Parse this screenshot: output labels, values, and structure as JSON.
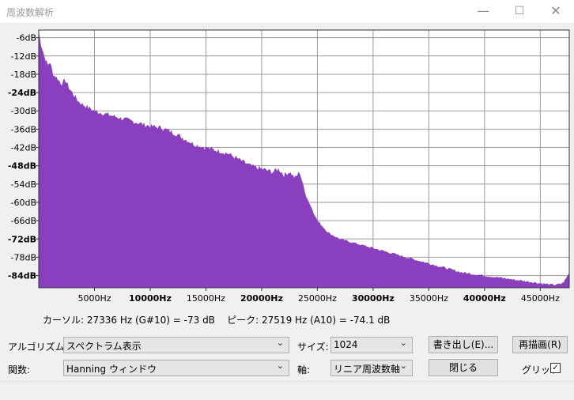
{
  "window": {
    "title": "周波数解析",
    "minimize_glyph": "—",
    "maximize_glyph": "☐",
    "close_glyph": "✕"
  },
  "chart_data": {
    "type": "area",
    "title": "",
    "xlabel": "",
    "ylabel": "",
    "fill_color": "#8a3fbf",
    "grid": true,
    "xlim": [
      0,
      47600
    ],
    "ylim": [
      -88,
      -3.5
    ],
    "x_ticks": [
      {
        "value": 5000,
        "label": "5000Hz",
        "bold": false
      },
      {
        "value": 10000,
        "label": "10000Hz",
        "bold": true
      },
      {
        "value": 15000,
        "label": "15000Hz",
        "bold": false
      },
      {
        "value": 20000,
        "label": "20000Hz",
        "bold": true
      },
      {
        "value": 25000,
        "label": "25000Hz",
        "bold": false
      },
      {
        "value": 30000,
        "label": "30000Hz",
        "bold": true
      },
      {
        "value": 35000,
        "label": "35000Hz",
        "bold": false
      },
      {
        "value": 40000,
        "label": "40000Hz",
        "bold": true
      },
      {
        "value": 45000,
        "label": "45000Hz",
        "bold": false
      }
    ],
    "y_ticks": [
      {
        "value": -6,
        "label": "-6dB",
        "bold": false
      },
      {
        "value": -12,
        "label": "-12dB",
        "bold": false
      },
      {
        "value": -18,
        "label": "-18dB",
        "bold": false
      },
      {
        "value": -24,
        "label": "-24dB",
        "bold": true
      },
      {
        "value": -30,
        "label": "-30dB",
        "bold": false
      },
      {
        "value": -36,
        "label": "-36dB",
        "bold": false
      },
      {
        "value": -42,
        "label": "-42dB",
        "bold": false
      },
      {
        "value": -48,
        "label": "-48dB",
        "bold": true
      },
      {
        "value": -54,
        "label": "-54dB",
        "bold": false
      },
      {
        "value": -60,
        "label": "-60dB",
        "bold": false
      },
      {
        "value": -66,
        "label": "-66dB",
        "bold": false
      },
      {
        "value": -72,
        "label": "-72dB",
        "bold": true
      },
      {
        "value": -78,
        "label": "-78dB",
        "bold": false
      },
      {
        "value": -84,
        "label": "-84dB",
        "bold": true
      }
    ],
    "series": [
      {
        "x": [
          0,
          200,
          500,
          800,
          1000,
          1300,
          1600,
          2000,
          2400,
          2800,
          3200,
          3600,
          4000,
          5000,
          6000,
          7000,
          8000,
          9000,
          10000,
          11000,
          12000,
          13000,
          14000,
          15000,
          16000,
          17000,
          18000,
          19000,
          20000,
          21000,
          21500,
          22000,
          22500,
          23000,
          23400,
          24000,
          25000,
          26000,
          27000,
          28000,
          29000,
          30000,
          31000,
          32000,
          33000,
          34000,
          35000,
          36000,
          37000,
          38000,
          39000,
          40000,
          41000,
          42000,
          43000,
          44000,
          45000,
          46000,
          46500,
          47000,
          47300,
          47600
        ],
        "y": [
          -4,
          -8,
          -12,
          -15,
          -14,
          -18,
          -19,
          -21,
          -20,
          -23,
          -25,
          -27,
          -28,
          -30,
          -31,
          -32,
          -33,
          -34,
          -35,
          -35.5,
          -37,
          -39,
          -41,
          -42,
          -43,
          -44,
          -46,
          -48,
          -49,
          -50,
          -49,
          -51,
          -50,
          -52,
          -50,
          -58,
          -66,
          -70,
          -72,
          -73,
          -74,
          -75,
          -76,
          -77,
          -78,
          -79,
          -80,
          -81,
          -82,
          -83,
          -83.5,
          -84,
          -84.5,
          -85,
          -85.5,
          -86,
          -86.5,
          -87,
          -87,
          -86.5,
          -85,
          -83
        ]
      }
    ]
  },
  "status": {
    "text": "カーソル: 27336 Hz (G#10) = -73 dB    ピーク: 27519 Hz (A10) = -74.1 dB"
  },
  "controls": {
    "algorithm_label": "アルゴリズム:",
    "algorithm_value": "スペクトラム表示",
    "size_label": "サイズ:",
    "size_value": "1024",
    "export_button": "書き出し(E)...",
    "replot_button": "再描画(R)",
    "function_label": "関数:",
    "function_value": "Hanning ウィンドウ",
    "axis_label": "軸:",
    "axis_value": "リニア周波数軸",
    "close_button": "閉じる",
    "grid_label": "グリッド",
    "grid_checked_glyph": "✓",
    "chevron_glyph": "⌄"
  }
}
